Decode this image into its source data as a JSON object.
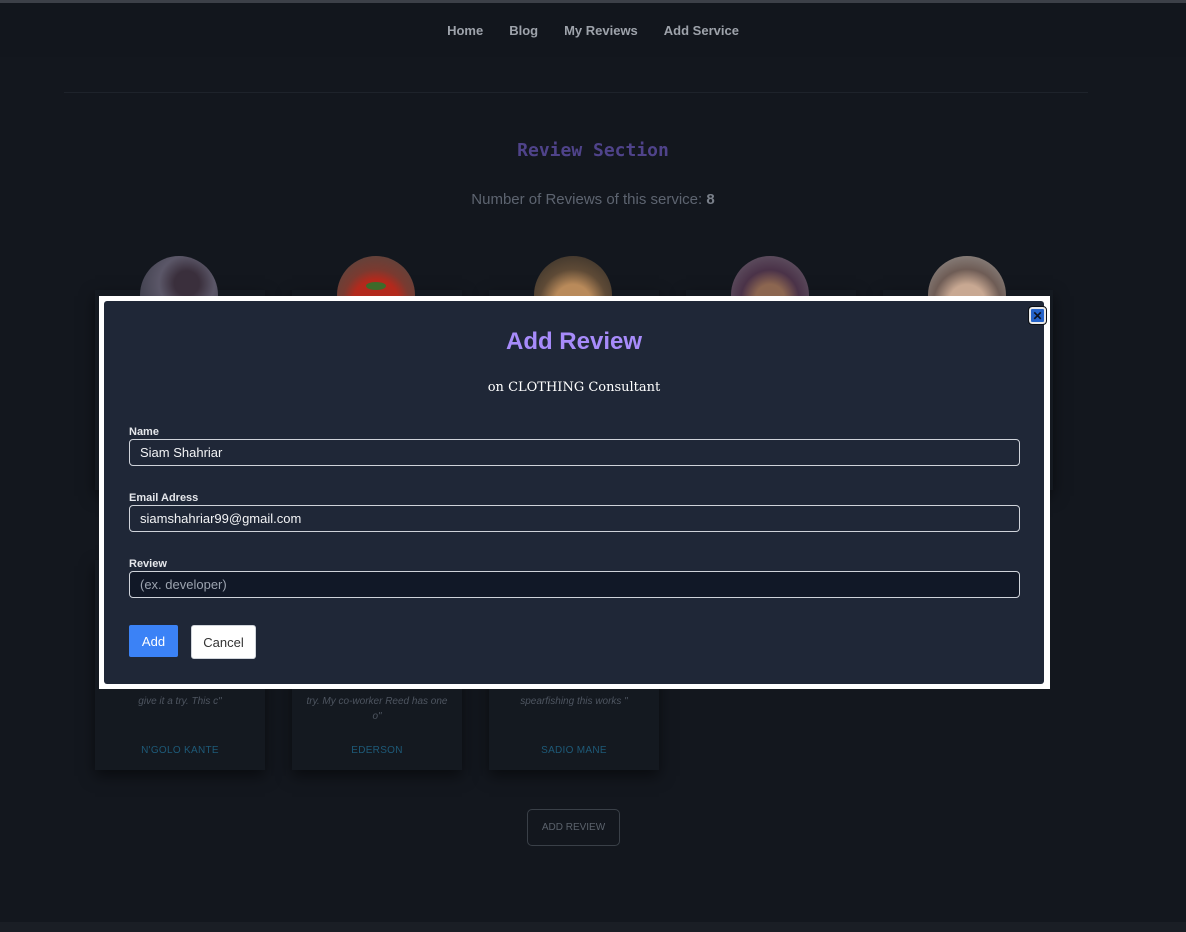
{
  "nav": {
    "items": [
      {
        "label": "Home"
      },
      {
        "label": "Blog"
      },
      {
        "label": "My Reviews"
      },
      {
        "label": "Add Service"
      }
    ]
  },
  "reviews_section": {
    "title": "Review Section",
    "count_prefix": "Number of Reviews of this service:",
    "count": "8"
  },
  "review_cards": [
    {
      "text_line1": "give it a try. This c\"",
      "text_line2": "",
      "name": "N'GOLO KANTE"
    },
    {
      "text_line1": "try. My co-worker Reed has one",
      "text_line2": "o\"",
      "name": "EDERSON"
    },
    {
      "text_line1": "spearfishing this works \"",
      "text_line2": "",
      "name": "SADIO MANE"
    }
  ],
  "add_review_button": "ADD REVIEW",
  "modal": {
    "title": "Add Review",
    "subtitle": "on CLOTHING Consultant",
    "close_icon": "close-icon",
    "name_label": "Name",
    "name_value": "Siam Shahriar",
    "email_label": "Email Adress",
    "email_value": "siamshahriar99@gmail.com",
    "review_label": "Review",
    "review_placeholder": "(ex. developer)",
    "add_label": "Add",
    "cancel_label": "Cancel"
  },
  "colors": {
    "modal_title": "#a78bfa",
    "modal_bg": "#1f2737",
    "primary_button": "#3b82f6",
    "section_title": "#4f438a"
  }
}
